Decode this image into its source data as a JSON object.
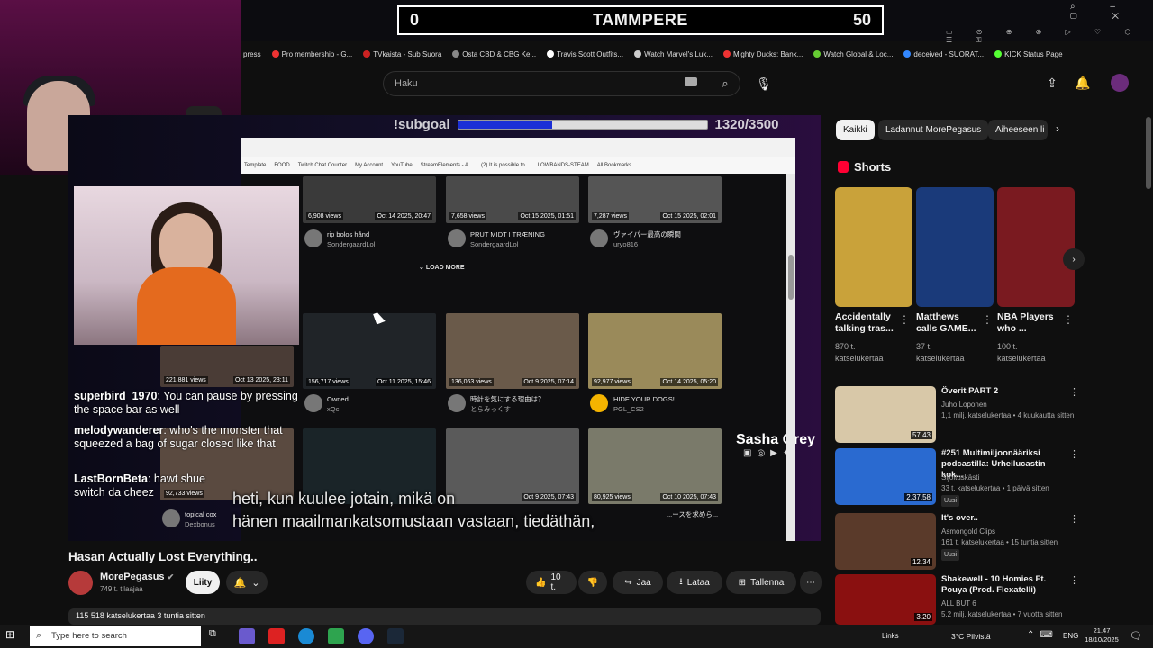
{
  "scoreboard": {
    "left_score": "0",
    "name": "TAMMPERE",
    "right_score": "50"
  },
  "bookmarks": [
    "press",
    "Pro membership - G...",
    "TVkaista - Sub Suora",
    "Osta CBD & CBG Ke...",
    "Travis Scott Outfits...",
    "Watch Marvel's Luk...",
    "Mighty Ducks: Bank...",
    "Watch Global & Loc...",
    "deceived - SUORAT...",
    "KICK Status Page"
  ],
  "header": {
    "search_placeholder": "Haku"
  },
  "stream": {
    "subgoal_label": "!subgoal",
    "subgoal_count": "1320/3500",
    "subgoal_progress": 0.377,
    "inner_bookmarks": [
      "Template",
      "FOOD",
      "Twitch Chat Counter",
      "My Account",
      "YouTube",
      "StreamElements - A...",
      "(2) It is possible to...",
      "LOWBANDS-STEAM",
      "All Bookmarks"
    ],
    "load_more": "LOAD MORE",
    "videos_top": [
      {
        "views": "6,908 views",
        "date": "Oct 14 2025, 20:47",
        "title": "rip bolos hånd",
        "channel": "SondergaardLol"
      },
      {
        "views": "7,658 views",
        "date": "Oct 15 2025, 01:51",
        "title": "PRUT MIDT I TRÆNING",
        "channel": "SondergaardLol"
      },
      {
        "views": "7,287 views",
        "date": "Oct 15 2025, 02:01",
        "title": "ヴァイパー最高の瞬間",
        "channel": "uryo816"
      }
    ],
    "videos_mid": [
      {
        "views": "221,881 views",
        "date": "Oct 13 2025, 23:11",
        "title": "",
        "channel": ""
      },
      {
        "views": "156,717 views",
        "date": "Oct 11 2025, 15:46",
        "title": "Owned",
        "channel": "xQc"
      },
      {
        "views": "136,063 views",
        "date": "Oct 9 2025, 07:14",
        "title": "時計を気にする理由は？",
        "channel": "とらみっくす"
      },
      {
        "views": "92,977 views",
        "date": "Oct 14 2025, 05:20",
        "title": "HIDE YOUR DOGS!",
        "channel": "PGL_CS2"
      }
    ],
    "videos_bottom": [
      {
        "views": "92,733 views",
        "date": "",
        "title": "topical cox",
        "channel": "Dexbonus"
      },
      {
        "views": "",
        "date": "",
        "title": "",
        "channel": ""
      },
      {
        "views": "",
        "date": "Oct 9 2025, 07:43",
        "title": "",
        "channel": ""
      },
      {
        "views": "80,925 views",
        "date": "Oct 10 2025, 07:43",
        "title": "...ースを求めら...",
        "channel": ""
      }
    ],
    "chat": [
      {
        "user": "superbird_1970",
        "text": ": You can pause by pressing the space bar as well"
      },
      {
        "user": "melodywanderer",
        "text": ": who's the monster that squeezed a bag of sugar closed like that"
      },
      {
        "user": "LastBornBeta",
        "text": ": hawt shue switch da cheez"
      }
    ],
    "subtitle_line1": "heti, kun kuulee jotain, mikä on",
    "subtitle_line2": "hänen maailmankatsomustaan vastaan, tiedäthän,",
    "guest_name": "Sasha Grey"
  },
  "video": {
    "title": "Hasan Actually Lost Everything..",
    "channel": "MorePegasus",
    "subscribers": "749 t. tilaajaa",
    "join_label": "Liity",
    "likes": "10 t.",
    "share_label": "Jaa",
    "download_label": "Lataa",
    "save_label": "Tallenna",
    "description": "115 518 katselukertaa  3 tuntia sitten"
  },
  "sidebar": {
    "chips": [
      "Kaikki",
      "Ladannut MorePegasus",
      "Aiheeseen li"
    ],
    "shorts_title": "Shorts",
    "shorts": [
      {
        "title": "Accidentally talking tras...",
        "views": "870 t. katselukertaa",
        "color": "#c9a23a"
      },
      {
        "title": "Matthews calls GAME...",
        "views": "37 t. katselukertaa",
        "color": "#1a3a7a"
      },
      {
        "title": "NBA Players who ...",
        "views": "100 t. katselukertaa",
        "color": "#7a1a20"
      }
    ],
    "recommended": [
      {
        "title": "Överit PART 2",
        "channel": "Juho Loponen",
        "meta": "1,1 milj. katselukertaa • 4 kuukautta sitten",
        "duration": "57.43",
        "badge": "",
        "color": "#d8c8a8"
      },
      {
        "title": "#251 Multimiljoonääriksi podcastilla: Urheilucastin kok...",
        "channel": "Sijoituskästi",
        "meta": "33 t. katselukertaa • 1 päivä sitten",
        "duration": "2.37.58",
        "badge": "Uusi",
        "color": "#2a6ad0"
      },
      {
        "title": "It's over..",
        "channel": "Asmongold Clips",
        "meta": "161 t. katselukertaa • 15 tuntia sitten",
        "duration": "12.34",
        "badge": "Uusi",
        "color": "#5a3a2a"
      },
      {
        "title": "Shakewell - 10 Homies Ft. Pouya (Prod. Flexatelli)",
        "channel": "ALL BUT 6",
        "meta": "5,2 milj. katselukertaa • 7 vuotta sitten",
        "duration": "3.20",
        "badge": "",
        "color": "#8a1010"
      }
    ]
  },
  "taskbar": {
    "search_placeholder": "Type here to search",
    "links": "Links",
    "weather": "3°C  Pilvistä",
    "lang": "ENG",
    "time": "21.47",
    "date": "18/10/2025"
  }
}
